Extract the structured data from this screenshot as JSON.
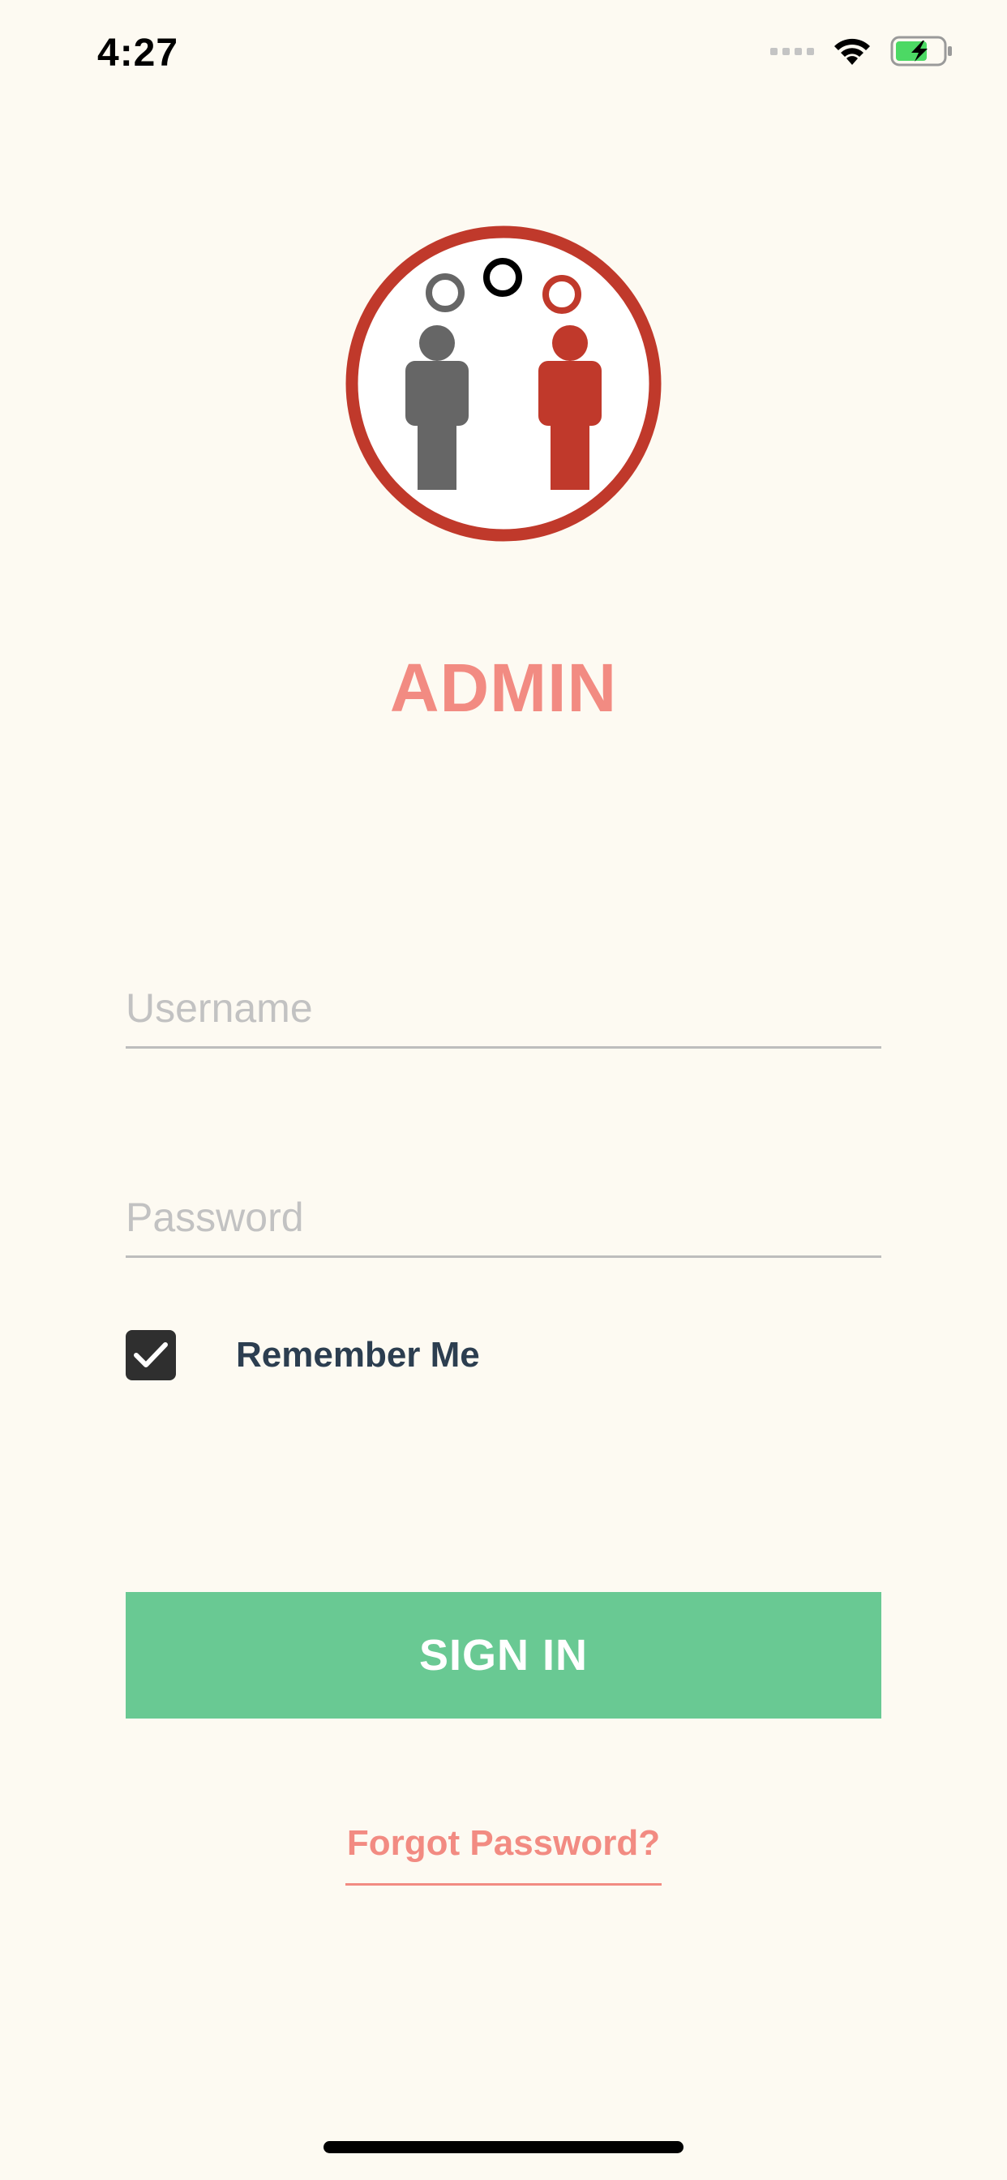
{
  "status_bar": {
    "time": "4:27",
    "icons": [
      "cellular-signal-icon",
      "wifi-icon",
      "battery-charging-icon"
    ]
  },
  "logo": {
    "description_icon": "two-people-logo-icon",
    "colors": {
      "ring": "#c0392b",
      "person_left": "#666666",
      "person_right": "#c0392b"
    }
  },
  "title": "ADMIN",
  "form": {
    "username": {
      "value": "",
      "placeholder": "Username"
    },
    "password": {
      "value": "",
      "placeholder": "Password"
    },
    "remember_me": {
      "label": "Remember Me",
      "checked": true
    },
    "sign_in_label": "SIGN IN",
    "forgot_password_label": "Forgot Password?"
  },
  "colors": {
    "background": "#fdfaf2",
    "accent": "#f28b82",
    "primary_button": "#69c993",
    "text_dark": "#2c3e50"
  }
}
